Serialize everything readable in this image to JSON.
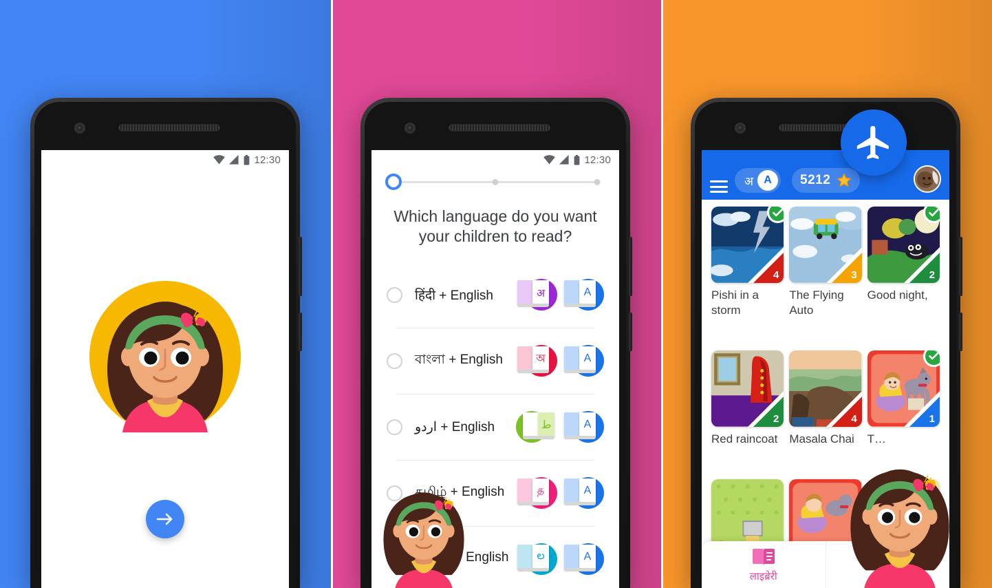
{
  "meta": {
    "panel_colors": {
      "blue": "#4285F4",
      "pink": "#E14997",
      "orange": "#F8962B"
    },
    "accent_blue": "#4285F4",
    "appbar_blue": "#1669E8",
    "check_green": "#27A63F",
    "label_pink": "#E0499A"
  },
  "status_bar": {
    "time": "12:30"
  },
  "screen1": {
    "next_label": "→"
  },
  "screen2": {
    "stepper": {
      "total_steps": 3,
      "current_step": 1
    },
    "question": "Which language do you want your children to read?",
    "options": [
      {
        "label": "हिंदी + English",
        "native_glyph": "अ",
        "english_glyph": "A",
        "native_color": "#9B27D6",
        "english_color": "#1A73E8",
        "page_color": "#E9C7F6",
        "selected": false
      },
      {
        "label": "বাংলা + English",
        "native_glyph": "অ",
        "english_glyph": "A",
        "native_color": "#E8123F",
        "english_color": "#1A73E8",
        "page_color": "#FBC7D2",
        "selected": false
      },
      {
        "label": "اردو + English",
        "native_glyph": "ط",
        "english_glyph": "A",
        "native_color": "#7CC224",
        "english_color": "#1A73E8",
        "page_color": "#DCEEB1",
        "selected": false
      },
      {
        "label": "தமிழ் + English",
        "native_glyph": "த",
        "english_glyph": "A",
        "native_color": "#ED1E79",
        "english_color": "#1A73E8",
        "page_color": "#FBC8E0",
        "selected": false
      },
      {
        "label": "తెలుగు + English",
        "native_glyph": "ల",
        "english_glyph": "A",
        "native_color": "#00A7CE",
        "english_color": "#1A73E8",
        "page_color": "#BEE5F4",
        "selected": false
      }
    ]
  },
  "screen3": {
    "appbar": {
      "menu_icon": "hamburger-icon",
      "lang_native": "अ",
      "lang_english": "A",
      "points": "5212",
      "points_icon": "star-icon",
      "profile_icon": "avatar"
    },
    "floating_action": {
      "icon": "airplane-icon"
    },
    "books": [
      {
        "title": "Pishi in a storm",
        "level": "4",
        "level_color": "#D32017",
        "completed": true,
        "cover": "storm"
      },
      {
        "title": "The Flying Auto",
        "level": "3",
        "level_color": "#F5A300",
        "completed": false,
        "cover": "flying-auto"
      },
      {
        "title": "Good night,",
        "level": "2",
        "level_color": "#1E8E3E",
        "completed": true,
        "cover": "goodnight"
      },
      {
        "title": "Red raincoat",
        "level": "2",
        "level_color": "#1E8E3E",
        "completed": false,
        "cover": "raincoat"
      },
      {
        "title": "Masala Chai",
        "level": "4",
        "level_color": "#D32017",
        "completed": false,
        "cover": "masala"
      },
      {
        "title": "T…",
        "level": "1",
        "level_color": "#1A73E8",
        "completed": true,
        "cover": "dog-girl"
      },
      {
        "title": "",
        "level": "",
        "level_color": "#1E8E3E",
        "completed": false,
        "cover": "green-dots"
      },
      {
        "title": "",
        "level": "",
        "level_color": "#D32017",
        "completed": false,
        "cover": "dog-girl2"
      },
      {
        "title": "",
        "level": "",
        "level_color": "#F5A300",
        "completed": false,
        "cover": "yellow"
      }
    ],
    "bottom_nav": [
      {
        "label": "लाइब्रेरी",
        "icon": "book-icon",
        "active": true
      },
      {
        "label": "",
        "icon": "trophy-icon",
        "active": false
      }
    ]
  }
}
